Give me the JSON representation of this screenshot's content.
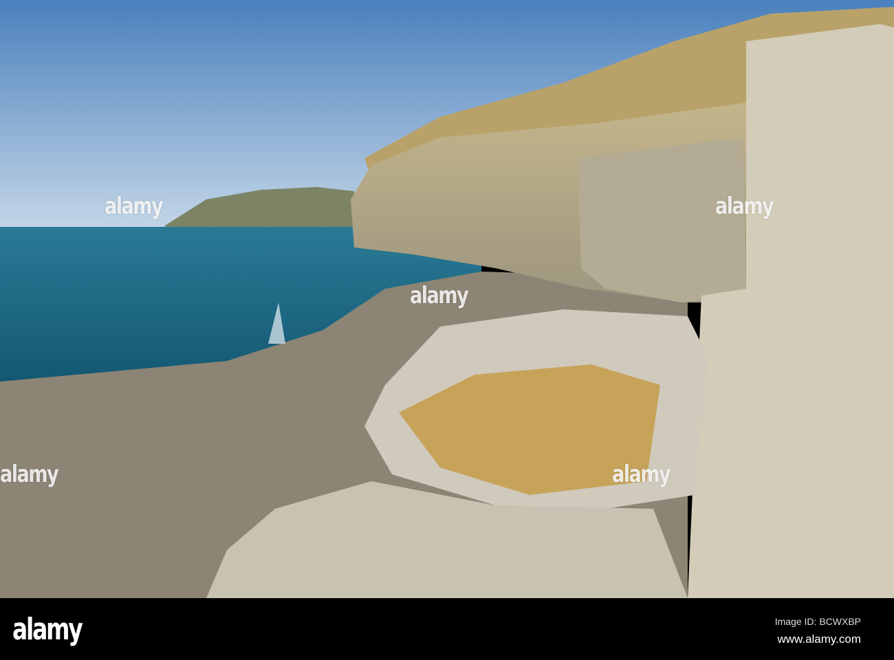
{
  "photo": {
    "subject": "coastal-cliffs-and-rocks",
    "colors": {
      "sky_top": "#4f86c0",
      "sky_bottom": "#c4d6e6",
      "sea": "#1e6a86",
      "cliff": "#b9ad8c",
      "rock": "#ccc6b6",
      "shelf": "#8a8272",
      "lichen": "#c99a3a"
    }
  },
  "watermark": {
    "text": "alamy"
  },
  "footer": {
    "logo": "alamy",
    "image_id": "Image ID: BCWXBP",
    "website": "www.alamy.com"
  }
}
